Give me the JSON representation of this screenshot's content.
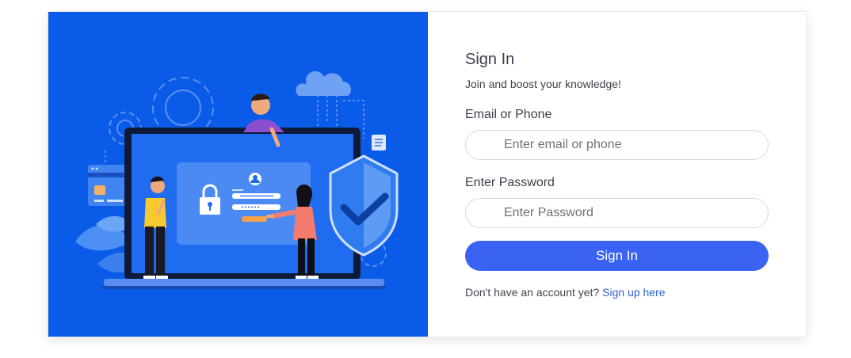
{
  "login": {
    "title": "Sign In",
    "subtitle": "Join and boost your knowledge!",
    "email_label": "Email or Phone",
    "email_placeholder": "Enter email or phone",
    "email_value": "",
    "password_label": "Enter Password",
    "password_placeholder": "Enter Password",
    "password_value": "",
    "submit_label": "Sign In",
    "signup_prompt": "Don't have an account yet?",
    "signup_link": "Sign up here"
  },
  "colors": {
    "panel_blue": "#0a5ce8",
    "button_blue": "#3b63f3",
    "link_blue": "#2c5fd6"
  }
}
